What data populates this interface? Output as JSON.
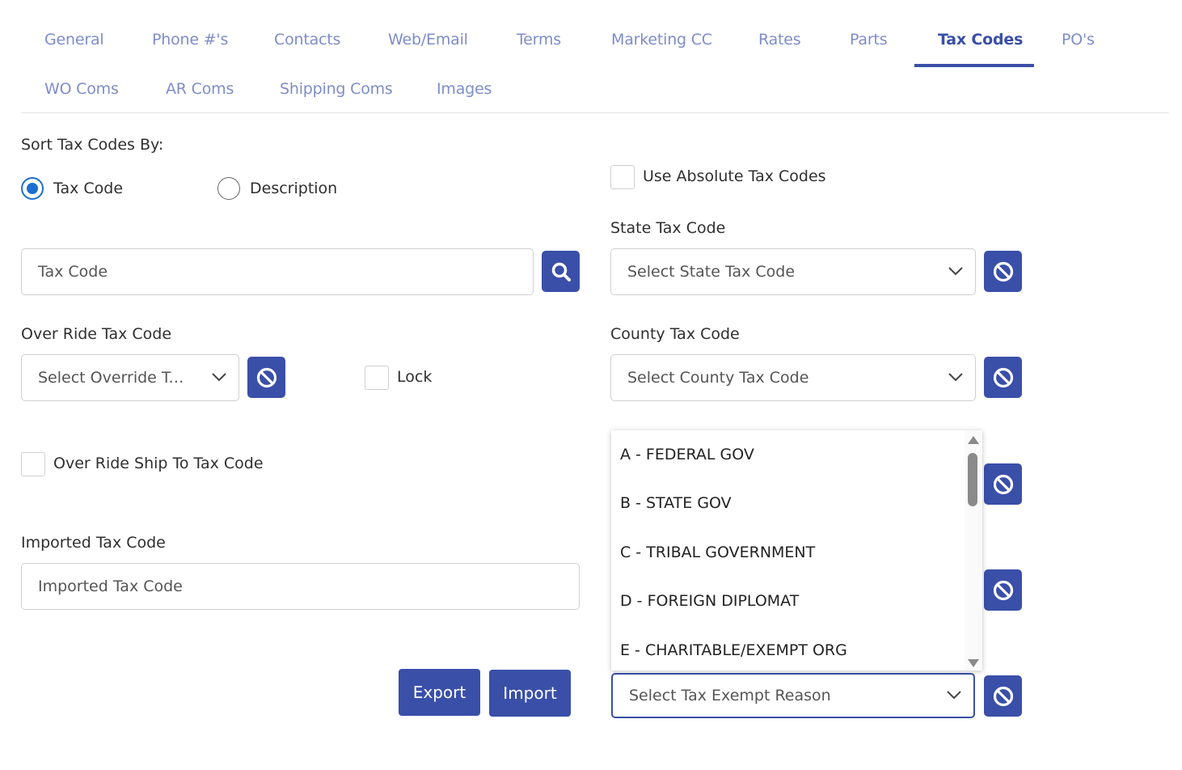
{
  "tabs": [
    {
      "label": "General",
      "active": false
    },
    {
      "label": "Phone #'s",
      "active": false
    },
    {
      "label": "Contacts",
      "active": false
    },
    {
      "label": "Web/Email",
      "active": false
    },
    {
      "label": "Terms",
      "active": false
    },
    {
      "label": "Marketing CC",
      "active": false
    },
    {
      "label": "Rates",
      "active": false
    },
    {
      "label": "Parts",
      "active": false
    },
    {
      "label": "Tax Codes",
      "active": true
    },
    {
      "label": "PO's",
      "active": false
    },
    {
      "label": "WO Coms",
      "active": false
    },
    {
      "label": "AR Coms",
      "active": false
    },
    {
      "label": "Shipping Coms",
      "active": false
    },
    {
      "label": "Images",
      "active": false
    }
  ],
  "sort": {
    "label": "Sort Tax Codes By:",
    "options": [
      {
        "label": "Tax Code",
        "checked": true
      },
      {
        "label": "Description",
        "checked": false
      }
    ]
  },
  "tax_code_input": {
    "placeholder": "Tax Code"
  },
  "override": {
    "label": "Over Ride Tax Code",
    "placeholder": "Select Override Ta...",
    "lock_label": "Lock"
  },
  "override_ship_to": {
    "label": "Over Ride Ship To Tax Code"
  },
  "imported": {
    "label": "Imported Tax Code",
    "placeholder": "Imported Tax Code"
  },
  "buttons": {
    "export": "Export",
    "import": "Import"
  },
  "absolute": {
    "label": "Use Absolute Tax Codes"
  },
  "state": {
    "label": "State Tax Code",
    "placeholder": "Select State Tax Code"
  },
  "county": {
    "label": "County Tax Code",
    "placeholder": "Select County Tax Code"
  },
  "exempt": {
    "placeholder": "Select Tax Exempt Reason",
    "options": [
      "A - FEDERAL GOV",
      "B - STATE GOV",
      "C - TRIBAL GOVERNMENT",
      "D - FOREIGN DIPLOMAT",
      "E - CHARITABLE/EXEMPT ORG"
    ]
  },
  "colors": {
    "accent": "#3a4fa8",
    "tab_inactive": "#7f8dc9",
    "radio": "#1c6fd1"
  }
}
